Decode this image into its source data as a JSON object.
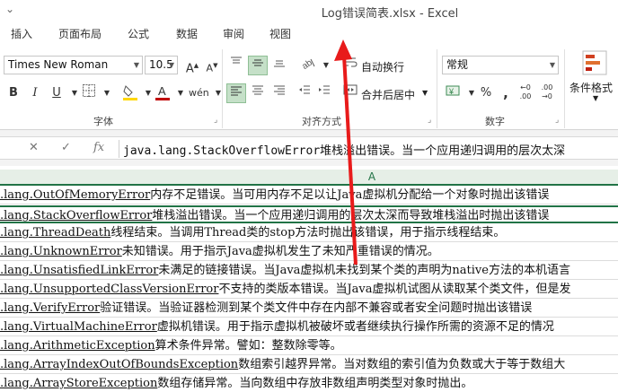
{
  "window": {
    "qat_glyph": "⌄",
    "title": "Log错误简表.xlsx - Excel"
  },
  "tabs": [
    "插入",
    "页面布局",
    "公式",
    "数据",
    "审阅",
    "视图"
  ],
  "ribbon": {
    "font_name": "Times New Roman",
    "font_size": "10.5",
    "wrap_text": "自动换行",
    "merge_center": "合并后居中",
    "number_format": "常规",
    "cond_format": "条件格式",
    "groups": {
      "font": "字体",
      "alignment": "对齐方式",
      "number": "数字"
    },
    "colors": {
      "font_color": "#c00000",
      "fill_color": "#ffd700",
      "selected_button": "#c5e0c8",
      "accent": "#217346"
    }
  },
  "formula_bar": {
    "cancel": "✕",
    "enter": "✓",
    "fx": "fx",
    "value": "java.lang.StackOverflowError堆栈溢出错误。当一个应用递归调用的层次太深"
  },
  "column_header": "A",
  "rows": [
    {
      "cls": ".lang.OutOfMemoryError",
      "text": "内存不足错误。当可用内存不足以让Java虚拟机分配给一个对象时抛出该错误"
    },
    {
      "cls": ".lang.StackOverflowError",
      "text": "堆栈溢出错误。当一个应用递归调用的层次太深而导致堆栈溢出时抛出该错误"
    },
    {
      "cls": ".lang.ThreadDeath",
      "text": "线程结束。当调用Thread类的stop方法时抛出该错误，用于指示线程结束。"
    },
    {
      "cls": ".lang.UnknownError",
      "text": "未知错误。用于指示Java虚拟机发生了未知严重错误的情况。"
    },
    {
      "cls": ".lang.UnsatisfiedLinkError",
      "text": "未满足的链接错误。当Java虚拟机未找到某个类的声明为native方法的本机语言"
    },
    {
      "cls": ".lang.UnsupportedClassVersionError",
      "text": "不支持的类版本错误。当Java虚拟机试图从读取某个类文件，但是发"
    },
    {
      "cls": ".lang.VerifyError",
      "text": "验证错误。当验证器检测到某个类文件中存在内部不兼容或者安全问题时抛出该错误"
    },
    {
      "cls": ".lang.VirtualMachineError",
      "text": "虚拟机错误。用于指示虚拟机被破坏或者继续执行操作所需的资源不足的情况"
    },
    {
      "cls": ".lang.ArithmeticException",
      "text": "算术条件异常。譬如：整数除零等。"
    },
    {
      "cls": ".lang.ArrayIndexOutOfBoundsException",
      "text": "数组索引越界异常。当对数组的索引值为负数或大于等于数组大"
    },
    {
      "cls": ".lang.ArrayStoreException",
      "text": "数组存储异常。当向数组中存放非数组声明类型对象时抛出。"
    }
  ],
  "selected_row_index": 1
}
